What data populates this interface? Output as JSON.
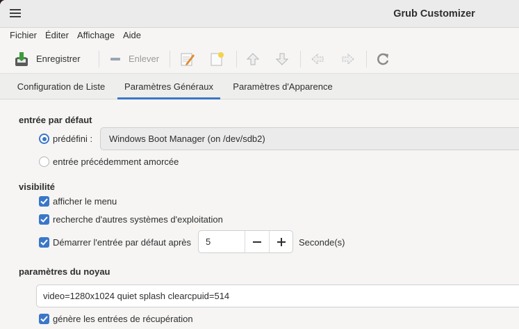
{
  "window": {
    "title": "Grub Customizer"
  },
  "menubar": {
    "items": [
      "Fichier",
      "Éditer",
      "Affichage",
      "Aide"
    ]
  },
  "toolbar": {
    "save_label": "Enregistrer",
    "remove_label": "Enlever"
  },
  "tabs": [
    {
      "label": "Configuration de Liste",
      "active": false
    },
    {
      "label": "Paramètres Généraux",
      "active": true
    },
    {
      "label": "Paramètres d'Apparence",
      "active": false
    }
  ],
  "default_entry": {
    "title": "entrée par défaut",
    "predefined_label": "prédéfini :",
    "predefined_selected": true,
    "predefined_value": "Windows Boot Manager (on /dev/sdb2)",
    "previous_label": "entrée précédemment amorcée",
    "previous_selected": false
  },
  "visibility": {
    "title": "visibilité",
    "show_menu_label": "afficher le menu",
    "show_menu_checked": true,
    "os_prober_label": "recherche d'autres systèmes d'exploitation",
    "os_prober_checked": true,
    "timeout_label": "Démarrer l'entrée par défaut après",
    "timeout_checked": true,
    "timeout_value": "5",
    "timeout_unit": "Seconde(s)"
  },
  "kernel": {
    "title": "paramètres du noyau",
    "params_value": "video=1280x1024 quiet splash clearcpuid=514",
    "recovery_label": "génère les entrées de récupération",
    "recovery_checked": true
  },
  "colors": {
    "accent": "#3a77c9"
  }
}
